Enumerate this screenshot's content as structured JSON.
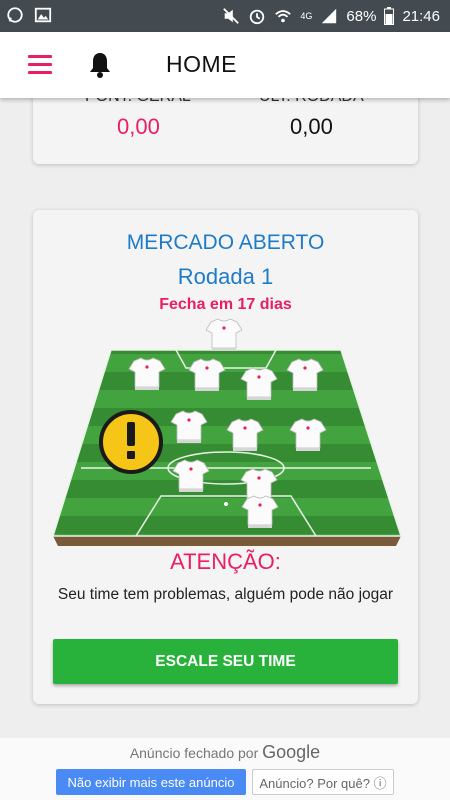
{
  "status_bar": {
    "battery": "68%",
    "time": "21:46",
    "network": "4G"
  },
  "app_bar": {
    "title": "HOME"
  },
  "stats": {
    "left_label": "PONT. GERAL",
    "left_value": "0,00",
    "right_label": "ULT. RODADA",
    "right_value": "0,00"
  },
  "market": {
    "title": "MERCADO ABERTO",
    "round": "Rodada 1",
    "closing": "Fecha em 17 dias",
    "warning_title": "ATENÇÃO:",
    "warning_message": "Seu time tem problemas, alguém pode não jogar",
    "cta_label": "ESCALE SEU TIME"
  },
  "ad": {
    "closed_text": "Anúncio fechado por",
    "closed_brand": "Google",
    "hide_button": "Não exibir mais este anúncio",
    "why_button": "Anúncio? Por quê? ⓘ"
  },
  "colors": {
    "accent_pink": "#e91e63",
    "title_blue": "#1e7bc8",
    "cta_green": "#28b23c",
    "field_green": "#3f9a3b",
    "warning_yellow": "#f5c518"
  },
  "icons": {
    "menu": "hamburger-menu-icon",
    "notifications": "bell-icon",
    "warning": "exclamation-warning-icon",
    "jersey": "shirt-icon"
  }
}
